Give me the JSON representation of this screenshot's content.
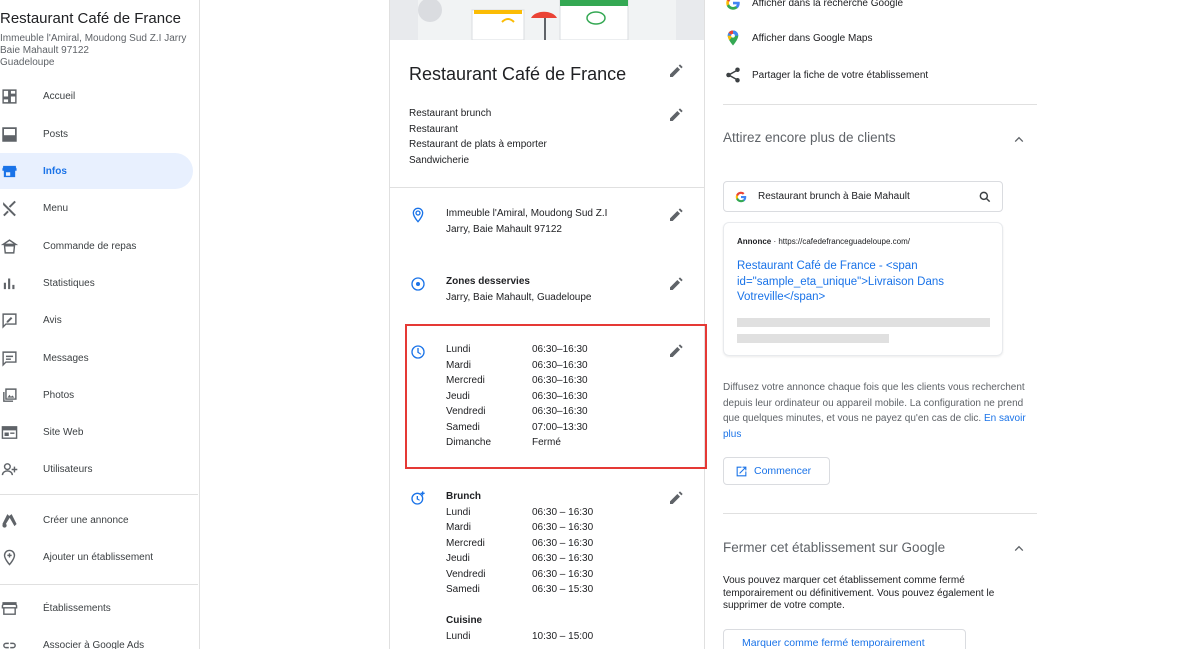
{
  "business": {
    "name": "Restaurant Café de France",
    "address": "Immeuble l'Amiral, Moudong Sud Z.I Jarry\nBaie Mahault 97122\nGuadeloupe"
  },
  "sidebar": {
    "items": [
      {
        "label": "Accueil",
        "icon": "dashboard-icon"
      },
      {
        "label": "Posts",
        "icon": "posts-icon"
      },
      {
        "label": "Infos",
        "icon": "store-icon",
        "active": true
      },
      {
        "label": "Menu",
        "icon": "utensils-icon"
      },
      {
        "label": "Commande de repas",
        "icon": "food-order-icon"
      },
      {
        "label": "Statistiques",
        "icon": "bar-chart-icon"
      },
      {
        "label": "Avis",
        "icon": "review-icon"
      },
      {
        "label": "Messages",
        "icon": "message-icon"
      },
      {
        "label": "Photos",
        "icon": "photos-icon"
      },
      {
        "label": "Site Web",
        "icon": "website-icon"
      },
      {
        "label": "Utilisateurs",
        "icon": "add-user-icon"
      }
    ],
    "extra": [
      {
        "label": "Créer une annonce",
        "icon": "google-ads-icon"
      },
      {
        "label": "Ajouter un établissement",
        "icon": "add-location-icon"
      }
    ],
    "bottom": [
      {
        "label": "Établissements",
        "icon": "storefront-icon"
      },
      {
        "label": "Associer à Google Ads",
        "icon": "link-icon"
      }
    ]
  },
  "info": {
    "title": "Restaurant Café de France",
    "categories": [
      "Restaurant brunch",
      "Restaurant",
      "Restaurant de plats à emporter",
      "Sandwicherie"
    ],
    "address_lines": [
      "Immeuble l'Amiral, Moudong Sud Z.I",
      "Jarry, Baie Mahault 97122"
    ],
    "zones_label": "Zones desservies",
    "zones_value": "Jarry, Baie Mahault, Guadeloupe",
    "hours": [
      {
        "day": "Lundi",
        "time": "06:30–16:30"
      },
      {
        "day": "Mardi",
        "time": "06:30–16:30"
      },
      {
        "day": "Mercredi",
        "time": "06:30–16:30"
      },
      {
        "day": "Jeudi",
        "time": "06:30–16:30"
      },
      {
        "day": "Vendredi",
        "time": "06:30–16:30"
      },
      {
        "day": "Samedi",
        "time": "07:00–13:30"
      },
      {
        "day": "Dimanche",
        "time": "Fermé"
      }
    ],
    "brunch_label": "Brunch",
    "brunch_hours": [
      {
        "day": "Lundi",
        "time": "06:30 – 16:30"
      },
      {
        "day": "Mardi",
        "time": "06:30 – 16:30"
      },
      {
        "day": "Mercredi",
        "time": "06:30 – 16:30"
      },
      {
        "day": "Jeudi",
        "time": "06:30 – 16:30"
      },
      {
        "day": "Vendredi",
        "time": "06:30 – 16:30"
      },
      {
        "day": "Samedi",
        "time": "06:30 – 15:30"
      }
    ],
    "cuisine_label": "Cuisine",
    "cuisine_hours": [
      {
        "day": "Lundi",
        "time": "10:30 – 15:00"
      }
    ]
  },
  "right": {
    "actions": [
      {
        "label": "Afficher dans la recherche Google",
        "icon": "google-icon"
      },
      {
        "label": "Afficher dans Google Maps",
        "icon": "google-maps-icon"
      },
      {
        "label": "Partager la fiche de votre établissement",
        "icon": "share-icon"
      }
    ],
    "promo_heading": "Attirez encore plus de clients",
    "search_query": "Restaurant brunch à Baie Mahault",
    "ad_label": "Annonce",
    "ad_url": "https://cafedefranceguadeloupe.com/",
    "ad_title": "Restaurant Café de France - <span id=\"sample_eta_unique\">Livraison Dans Votreville</span>",
    "promo_text": "Diffusez votre annonce chaque fois que les clients vous recherchent depuis leur ordinateur ou appareil mobile. La configuration ne prend que quelques minutes, et vous ne payez qu'en cas de clic.",
    "promo_link": "En savoir plus",
    "start_button": "Commencer",
    "close_heading": "Fermer cet établissement sur Google",
    "close_text": "Vous pouvez marquer cet établissement comme fermé temporairement ou définitivement. Vous pouvez également le supprimer de votre compte.",
    "close_button": "Marquer comme fermé temporairement"
  }
}
